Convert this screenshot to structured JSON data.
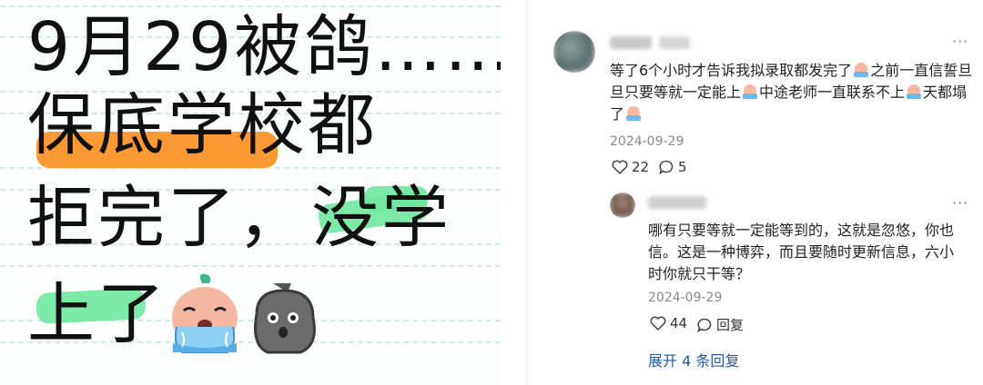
{
  "post_image": {
    "line1": "9月29被鸽……",
    "line2": "保底学校都",
    "line3a": "拒完了，",
    "line3b": "没学",
    "line4": "上了",
    "emojis": [
      "crying-face-emoji",
      "stone-face-emoji"
    ]
  },
  "comments": [
    {
      "username": "",
      "text_parts": [
        "等了6个小时才告诉我拟录取都发完了",
        "之前一直信誓旦旦只要等就一定能上",
        "中途老师一直联系不上",
        "天都塌了"
      ],
      "date": "2024-09-29",
      "likes": "22",
      "replies": "5",
      "more": "···"
    },
    {
      "username": "",
      "text": "哪有只要等就一定能等到的，这就是忽悠，你也信。这是一种博弈，而且要随时更新信息，六小时你就只干等？",
      "date": "2024-09-29",
      "likes": "44",
      "reply_label": "回复",
      "more": "···"
    }
  ],
  "expand_label": "展开 4 条回复",
  "colors": {
    "orange_highlight": "#fb9a34",
    "green_highlight": "#6fe8a0",
    "link": "#1f5aa8"
  }
}
